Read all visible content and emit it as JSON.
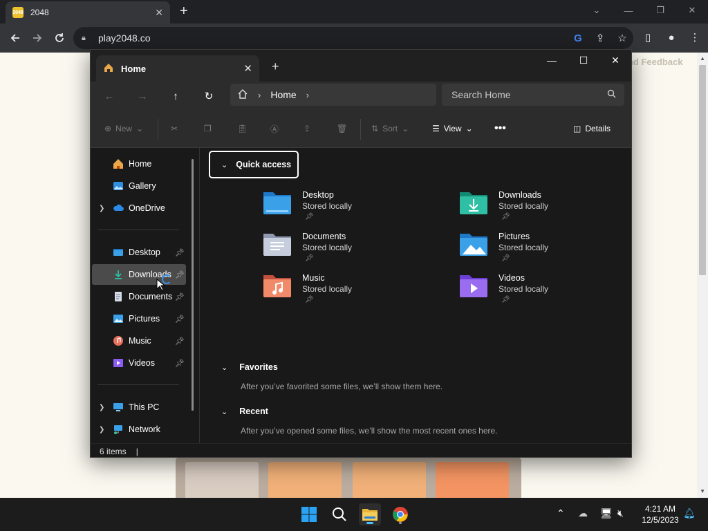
{
  "browser": {
    "tab_title": "2048",
    "favicon_text": "2048",
    "url": "play2048.co"
  },
  "site": {
    "feedback_text": "nd Feedback"
  },
  "explorer": {
    "tab_title": "Home",
    "breadcrumb": "Home",
    "search_placeholder": "Search Home",
    "commands": {
      "new": "New",
      "sort": "Sort",
      "view": "View",
      "details": "Details"
    },
    "sidebar": {
      "top": [
        {
          "label": "Home",
          "icon": "home-icon"
        },
        {
          "label": "Gallery",
          "icon": "gallery-icon"
        },
        {
          "label": "OneDrive",
          "icon": "onedrive-icon"
        }
      ],
      "pinned": [
        {
          "label": "Desktop",
          "icon": "desktop-folder-icon"
        },
        {
          "label": "Downloads",
          "icon": "downloads-folder-icon"
        },
        {
          "label": "Documents",
          "icon": "documents-folder-icon"
        },
        {
          "label": "Pictures",
          "icon": "pictures-folder-icon"
        },
        {
          "label": "Music",
          "icon": "music-folder-icon"
        },
        {
          "label": "Videos",
          "icon": "videos-folder-icon"
        }
      ],
      "bottom": [
        {
          "label": "This PC",
          "icon": "this-pc-icon"
        },
        {
          "label": "Network",
          "icon": "network-icon"
        }
      ]
    },
    "quick_access": {
      "title": "Quick access",
      "items": [
        {
          "name": "Desktop",
          "status": "Stored locally"
        },
        {
          "name": "Downloads",
          "status": "Stored locally"
        },
        {
          "name": "Documents",
          "status": "Stored locally"
        },
        {
          "name": "Pictures",
          "status": "Stored locally"
        },
        {
          "name": "Music",
          "status": "Stored locally"
        },
        {
          "name": "Videos",
          "status": "Stored locally"
        }
      ]
    },
    "favorites": {
      "title": "Favorites",
      "message": "After you’ve favorited some files, we’ll show them here."
    },
    "recent": {
      "title": "Recent",
      "message": "After you’ve opened some files, we’ll show the most recent ones here."
    },
    "status": "6 items"
  },
  "taskbar": {
    "time": "4:21 AM",
    "date": "12/5/2023"
  },
  "colors": {
    "accent": "#4cc2ff",
    "explorer_bg": "#191919",
    "chrome_bg": "#35363a"
  }
}
